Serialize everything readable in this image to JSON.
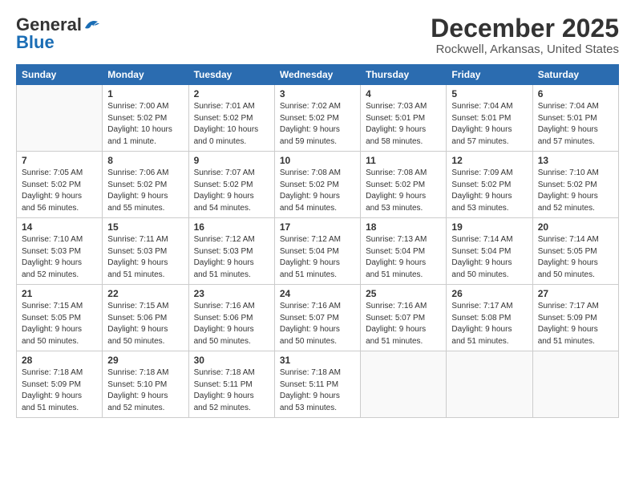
{
  "logo": {
    "line1": "General",
    "line2": "Blue"
  },
  "title": "December 2025",
  "location": "Rockwell, Arkansas, United States",
  "days_of_week": [
    "Sunday",
    "Monday",
    "Tuesday",
    "Wednesday",
    "Thursday",
    "Friday",
    "Saturday"
  ],
  "weeks": [
    [
      {
        "day": "",
        "info": ""
      },
      {
        "day": "1",
        "info": "Sunrise: 7:00 AM\nSunset: 5:02 PM\nDaylight: 10 hours\nand 1 minute."
      },
      {
        "day": "2",
        "info": "Sunrise: 7:01 AM\nSunset: 5:02 PM\nDaylight: 10 hours\nand 0 minutes."
      },
      {
        "day": "3",
        "info": "Sunrise: 7:02 AM\nSunset: 5:02 PM\nDaylight: 9 hours\nand 59 minutes."
      },
      {
        "day": "4",
        "info": "Sunrise: 7:03 AM\nSunset: 5:01 PM\nDaylight: 9 hours\nand 58 minutes."
      },
      {
        "day": "5",
        "info": "Sunrise: 7:04 AM\nSunset: 5:01 PM\nDaylight: 9 hours\nand 57 minutes."
      },
      {
        "day": "6",
        "info": "Sunrise: 7:04 AM\nSunset: 5:01 PM\nDaylight: 9 hours\nand 57 minutes."
      }
    ],
    [
      {
        "day": "7",
        "info": "Sunrise: 7:05 AM\nSunset: 5:02 PM\nDaylight: 9 hours\nand 56 minutes."
      },
      {
        "day": "8",
        "info": "Sunrise: 7:06 AM\nSunset: 5:02 PM\nDaylight: 9 hours\nand 55 minutes."
      },
      {
        "day": "9",
        "info": "Sunrise: 7:07 AM\nSunset: 5:02 PM\nDaylight: 9 hours\nand 54 minutes."
      },
      {
        "day": "10",
        "info": "Sunrise: 7:08 AM\nSunset: 5:02 PM\nDaylight: 9 hours\nand 54 minutes."
      },
      {
        "day": "11",
        "info": "Sunrise: 7:08 AM\nSunset: 5:02 PM\nDaylight: 9 hours\nand 53 minutes."
      },
      {
        "day": "12",
        "info": "Sunrise: 7:09 AM\nSunset: 5:02 PM\nDaylight: 9 hours\nand 53 minutes."
      },
      {
        "day": "13",
        "info": "Sunrise: 7:10 AM\nSunset: 5:02 PM\nDaylight: 9 hours\nand 52 minutes."
      }
    ],
    [
      {
        "day": "14",
        "info": "Sunrise: 7:10 AM\nSunset: 5:03 PM\nDaylight: 9 hours\nand 52 minutes."
      },
      {
        "day": "15",
        "info": "Sunrise: 7:11 AM\nSunset: 5:03 PM\nDaylight: 9 hours\nand 51 minutes."
      },
      {
        "day": "16",
        "info": "Sunrise: 7:12 AM\nSunset: 5:03 PM\nDaylight: 9 hours\nand 51 minutes."
      },
      {
        "day": "17",
        "info": "Sunrise: 7:12 AM\nSunset: 5:04 PM\nDaylight: 9 hours\nand 51 minutes."
      },
      {
        "day": "18",
        "info": "Sunrise: 7:13 AM\nSunset: 5:04 PM\nDaylight: 9 hours\nand 51 minutes."
      },
      {
        "day": "19",
        "info": "Sunrise: 7:14 AM\nSunset: 5:04 PM\nDaylight: 9 hours\nand 50 minutes."
      },
      {
        "day": "20",
        "info": "Sunrise: 7:14 AM\nSunset: 5:05 PM\nDaylight: 9 hours\nand 50 minutes."
      }
    ],
    [
      {
        "day": "21",
        "info": "Sunrise: 7:15 AM\nSunset: 5:05 PM\nDaylight: 9 hours\nand 50 minutes."
      },
      {
        "day": "22",
        "info": "Sunrise: 7:15 AM\nSunset: 5:06 PM\nDaylight: 9 hours\nand 50 minutes."
      },
      {
        "day": "23",
        "info": "Sunrise: 7:16 AM\nSunset: 5:06 PM\nDaylight: 9 hours\nand 50 minutes."
      },
      {
        "day": "24",
        "info": "Sunrise: 7:16 AM\nSunset: 5:07 PM\nDaylight: 9 hours\nand 50 minutes."
      },
      {
        "day": "25",
        "info": "Sunrise: 7:16 AM\nSunset: 5:07 PM\nDaylight: 9 hours\nand 51 minutes."
      },
      {
        "day": "26",
        "info": "Sunrise: 7:17 AM\nSunset: 5:08 PM\nDaylight: 9 hours\nand 51 minutes."
      },
      {
        "day": "27",
        "info": "Sunrise: 7:17 AM\nSunset: 5:09 PM\nDaylight: 9 hours\nand 51 minutes."
      }
    ],
    [
      {
        "day": "28",
        "info": "Sunrise: 7:18 AM\nSunset: 5:09 PM\nDaylight: 9 hours\nand 51 minutes."
      },
      {
        "day": "29",
        "info": "Sunrise: 7:18 AM\nSunset: 5:10 PM\nDaylight: 9 hours\nand 52 minutes."
      },
      {
        "day": "30",
        "info": "Sunrise: 7:18 AM\nSunset: 5:11 PM\nDaylight: 9 hours\nand 52 minutes."
      },
      {
        "day": "31",
        "info": "Sunrise: 7:18 AM\nSunset: 5:11 PM\nDaylight: 9 hours\nand 53 minutes."
      },
      {
        "day": "",
        "info": ""
      },
      {
        "day": "",
        "info": ""
      },
      {
        "day": "",
        "info": ""
      }
    ]
  ]
}
